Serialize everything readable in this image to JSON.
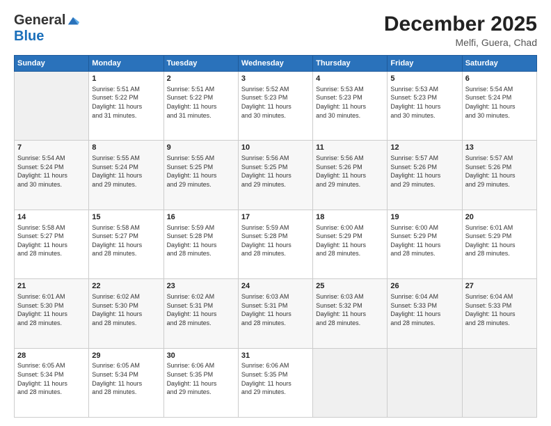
{
  "logo": {
    "general": "General",
    "blue": "Blue"
  },
  "header": {
    "month": "December 2025",
    "location": "Melfi, Guera, Chad"
  },
  "days_of_week": [
    "Sunday",
    "Monday",
    "Tuesday",
    "Wednesday",
    "Thursday",
    "Friday",
    "Saturday"
  ],
  "weeks": [
    [
      {
        "day": "",
        "info": ""
      },
      {
        "day": "1",
        "info": "Sunrise: 5:51 AM\nSunset: 5:22 PM\nDaylight: 11 hours\nand 31 minutes."
      },
      {
        "day": "2",
        "info": "Sunrise: 5:51 AM\nSunset: 5:22 PM\nDaylight: 11 hours\nand 31 minutes."
      },
      {
        "day": "3",
        "info": "Sunrise: 5:52 AM\nSunset: 5:23 PM\nDaylight: 11 hours\nand 30 minutes."
      },
      {
        "day": "4",
        "info": "Sunrise: 5:53 AM\nSunset: 5:23 PM\nDaylight: 11 hours\nand 30 minutes."
      },
      {
        "day": "5",
        "info": "Sunrise: 5:53 AM\nSunset: 5:23 PM\nDaylight: 11 hours\nand 30 minutes."
      },
      {
        "day": "6",
        "info": "Sunrise: 5:54 AM\nSunset: 5:24 PM\nDaylight: 11 hours\nand 30 minutes."
      }
    ],
    [
      {
        "day": "7",
        "info": "Sunrise: 5:54 AM\nSunset: 5:24 PM\nDaylight: 11 hours\nand 30 minutes."
      },
      {
        "day": "8",
        "info": "Sunrise: 5:55 AM\nSunset: 5:24 PM\nDaylight: 11 hours\nand 29 minutes."
      },
      {
        "day": "9",
        "info": "Sunrise: 5:55 AM\nSunset: 5:25 PM\nDaylight: 11 hours\nand 29 minutes."
      },
      {
        "day": "10",
        "info": "Sunrise: 5:56 AM\nSunset: 5:25 PM\nDaylight: 11 hours\nand 29 minutes."
      },
      {
        "day": "11",
        "info": "Sunrise: 5:56 AM\nSunset: 5:26 PM\nDaylight: 11 hours\nand 29 minutes."
      },
      {
        "day": "12",
        "info": "Sunrise: 5:57 AM\nSunset: 5:26 PM\nDaylight: 11 hours\nand 29 minutes."
      },
      {
        "day": "13",
        "info": "Sunrise: 5:57 AM\nSunset: 5:26 PM\nDaylight: 11 hours\nand 29 minutes."
      }
    ],
    [
      {
        "day": "14",
        "info": "Sunrise: 5:58 AM\nSunset: 5:27 PM\nDaylight: 11 hours\nand 28 minutes."
      },
      {
        "day": "15",
        "info": "Sunrise: 5:58 AM\nSunset: 5:27 PM\nDaylight: 11 hours\nand 28 minutes."
      },
      {
        "day": "16",
        "info": "Sunrise: 5:59 AM\nSunset: 5:28 PM\nDaylight: 11 hours\nand 28 minutes."
      },
      {
        "day": "17",
        "info": "Sunrise: 5:59 AM\nSunset: 5:28 PM\nDaylight: 11 hours\nand 28 minutes."
      },
      {
        "day": "18",
        "info": "Sunrise: 6:00 AM\nSunset: 5:29 PM\nDaylight: 11 hours\nand 28 minutes."
      },
      {
        "day": "19",
        "info": "Sunrise: 6:00 AM\nSunset: 5:29 PM\nDaylight: 11 hours\nand 28 minutes."
      },
      {
        "day": "20",
        "info": "Sunrise: 6:01 AM\nSunset: 5:29 PM\nDaylight: 11 hours\nand 28 minutes."
      }
    ],
    [
      {
        "day": "21",
        "info": "Sunrise: 6:01 AM\nSunset: 5:30 PM\nDaylight: 11 hours\nand 28 minutes."
      },
      {
        "day": "22",
        "info": "Sunrise: 6:02 AM\nSunset: 5:30 PM\nDaylight: 11 hours\nand 28 minutes."
      },
      {
        "day": "23",
        "info": "Sunrise: 6:02 AM\nSunset: 5:31 PM\nDaylight: 11 hours\nand 28 minutes."
      },
      {
        "day": "24",
        "info": "Sunrise: 6:03 AM\nSunset: 5:31 PM\nDaylight: 11 hours\nand 28 minutes."
      },
      {
        "day": "25",
        "info": "Sunrise: 6:03 AM\nSunset: 5:32 PM\nDaylight: 11 hours\nand 28 minutes."
      },
      {
        "day": "26",
        "info": "Sunrise: 6:04 AM\nSunset: 5:33 PM\nDaylight: 11 hours\nand 28 minutes."
      },
      {
        "day": "27",
        "info": "Sunrise: 6:04 AM\nSunset: 5:33 PM\nDaylight: 11 hours\nand 28 minutes."
      }
    ],
    [
      {
        "day": "28",
        "info": "Sunrise: 6:05 AM\nSunset: 5:34 PM\nDaylight: 11 hours\nand 28 minutes."
      },
      {
        "day": "29",
        "info": "Sunrise: 6:05 AM\nSunset: 5:34 PM\nDaylight: 11 hours\nand 28 minutes."
      },
      {
        "day": "30",
        "info": "Sunrise: 6:06 AM\nSunset: 5:35 PM\nDaylight: 11 hours\nand 29 minutes."
      },
      {
        "day": "31",
        "info": "Sunrise: 6:06 AM\nSunset: 5:35 PM\nDaylight: 11 hours\nand 29 minutes."
      },
      {
        "day": "",
        "info": ""
      },
      {
        "day": "",
        "info": ""
      },
      {
        "day": "",
        "info": ""
      }
    ]
  ]
}
